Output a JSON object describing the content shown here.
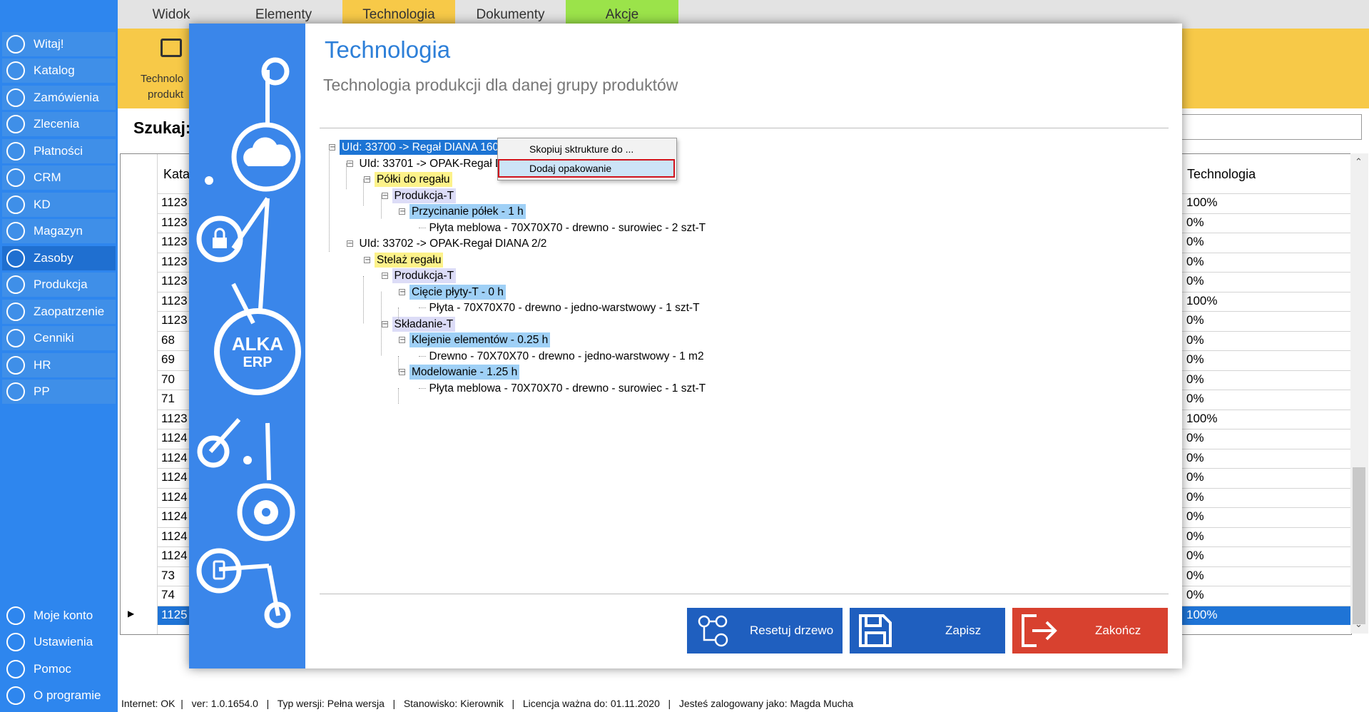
{
  "app": {
    "tabs": [
      "Widok",
      "Elementy",
      "Technologia",
      "Dokumenty",
      "Akcje"
    ],
    "tab_colors": [
      "#e3e3e3",
      "#e3e3e3",
      "#f7c948",
      "#e3e3e3",
      "#9be34a"
    ]
  },
  "sidebar": {
    "items": [
      {
        "label": "Witaj!",
        "icon": "home-icon"
      },
      {
        "label": "Katalog",
        "icon": "book-icon"
      },
      {
        "label": "Zamówienia",
        "icon": "cart-icon"
      },
      {
        "label": "Zlecenia",
        "icon": "list-icon"
      },
      {
        "label": "Płatności",
        "icon": "dollar-icon"
      },
      {
        "label": "CRM",
        "icon": "crm-icon"
      },
      {
        "label": "KD",
        "icon": "user-icon"
      },
      {
        "label": "Magazyn",
        "icon": "warehouse-icon"
      },
      {
        "label": "Zasoby",
        "icon": "box-icon"
      },
      {
        "label": "Produkcja",
        "icon": "production-icon"
      },
      {
        "label": "Zaopatrzenie",
        "icon": "truck-icon"
      },
      {
        "label": "Cenniki",
        "icon": "tag-icon"
      },
      {
        "label": "HR",
        "icon": "hr-icon"
      },
      {
        "label": "PP",
        "icon": "pp-icon"
      }
    ],
    "active": "Zasoby",
    "bottom_items": [
      {
        "label": "Moje konto",
        "icon": "account-icon"
      },
      {
        "label": "Ustawienia",
        "icon": "settings-icon"
      },
      {
        "label": "Pomoc",
        "icon": "help-icon"
      },
      {
        "label": "O programie",
        "icon": "info-icon"
      }
    ]
  },
  "ribbon": {
    "button_label_line1": "Technolo",
    "button_label_line2": "produkt"
  },
  "search": {
    "label": "Szukaj:"
  },
  "grid": {
    "header_left": "Kata",
    "header_right": "Technologia",
    "left_col": [
      "1123",
      "1123",
      "1123",
      "1123",
      "1123",
      "1123",
      "1123",
      "68",
      "69",
      "70",
      "71",
      "1123",
      "1124",
      "1124",
      "1124",
      "1124",
      "1124",
      "1124",
      "1124",
      "73",
      "74",
      "1125"
    ],
    "right_col": [
      "100%",
      "0%",
      "0%",
      "0%",
      "0%",
      "100%",
      "0%",
      "0%",
      "0%",
      "0%",
      "0%",
      "100%",
      "0%",
      "0%",
      "0%",
      "0%",
      "0%",
      "0%",
      "0%",
      "0%",
      "0%",
      "100%"
    ],
    "selected_row": 21
  },
  "status_bar": {
    "text": "Internet: OK  |   ver: 1.0.1654.0   |   Typ wersji: Pełna wersja   |   Stanowisko: Kierownik   |   Licencja ważna do: 01.11.2020   |   Jesteś zalogowany jako: Magda Mucha"
  },
  "dialog": {
    "title": "Technologia",
    "subtitle": "Technologia produkcji dla danej grupy produktów",
    "logo_line1": "ALKA",
    "logo_line2": "ERP",
    "tree": [
      {
        "text": "UId: 33700 -> Regał DIANA 160X080X30 T Biały T",
        "style": "root"
      },
      {
        "text": "UId: 33701 -> OPAK-Regał DIANA  1/2",
        "style": "plain"
      },
      {
        "text": "Półki do regału",
        "style": "yellow"
      },
      {
        "text": "Produkcja-T",
        "style": "lav"
      },
      {
        "text": "Przycinanie półek - 1 h",
        "style": "blue"
      },
      {
        "text": "Płyta meblowa - 70X70X70 -  drewno -  surowiec -  2 szt-T",
        "style": "plain"
      },
      {
        "text": "UId: 33702 -> OPAK-Regał DIANA   2/2",
        "style": "plain"
      },
      {
        "text": "Stelaż regału",
        "style": "yellow"
      },
      {
        "text": "Produkcja-T",
        "style": "lav"
      },
      {
        "text": "Cięcie płyty-T - 0 h",
        "style": "blue"
      },
      {
        "text": "Płyta - 70X70X70 -  drewno -  jedno-warstwowy -  1 szt-T",
        "style": "plain"
      },
      {
        "text": "Składanie-T",
        "style": "lav"
      },
      {
        "text": "Klejenie elementów - 0.25 h",
        "style": "blue"
      },
      {
        "text": "Drewno - 70X70X70 -  drewno -  jedno-warstwowy -  1 m2",
        "style": "plain"
      },
      {
        "text": "Modelowanie - 1.25 h",
        "style": "blue"
      },
      {
        "text": "Płyta meblowa - 70X70X70 -  drewno -  surowiec -  1 szt-T",
        "style": "plain"
      }
    ],
    "context_menu": [
      "Skopiuj sktrukture do ...",
      "Dodaj opakowanie"
    ],
    "buttons": {
      "reset": "Resetuj drzewo",
      "save": "Zapisz",
      "close": "Zakończ"
    },
    "colors": {
      "reset": "#1f5fbf",
      "save": "#1f5fbf",
      "close": "#d8412f",
      "accent": "#2d7fd8"
    }
  }
}
